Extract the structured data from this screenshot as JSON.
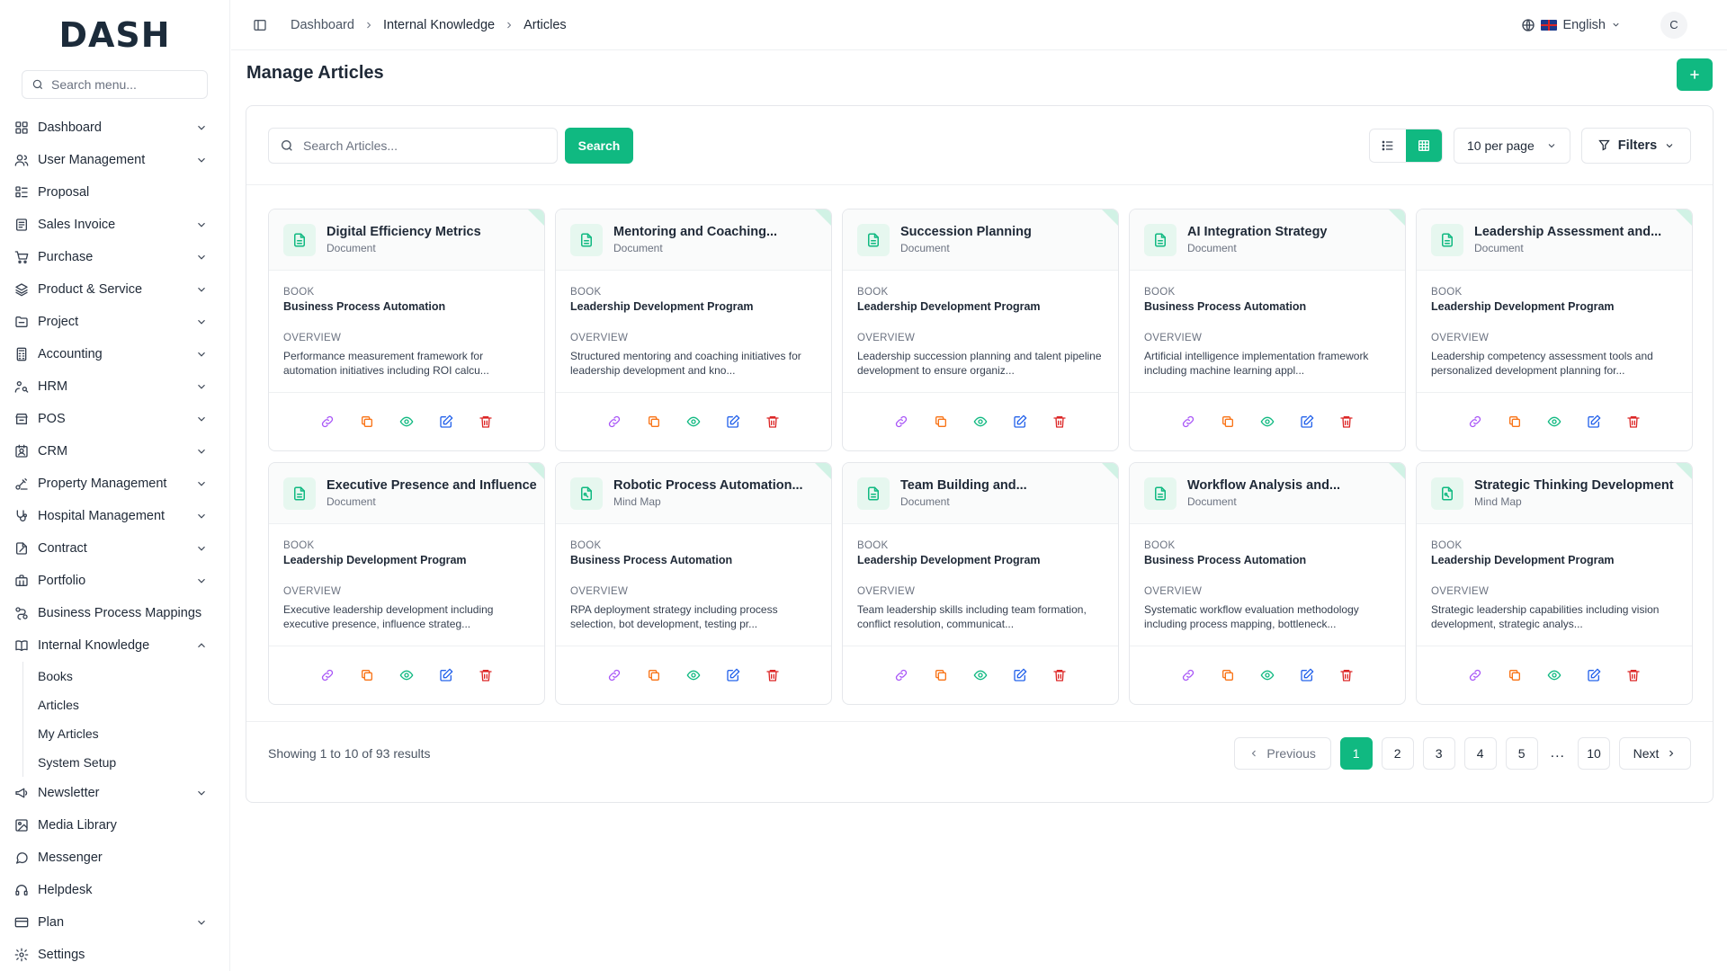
{
  "brand": {
    "logo_text": "DASH"
  },
  "sidebar": {
    "search_placeholder": "Search menu...",
    "items": [
      {
        "label": "Dashboard",
        "icon": "dashboard-icon",
        "chevron": "down"
      },
      {
        "label": "User Management",
        "icon": "users-icon",
        "chevron": "down"
      },
      {
        "label": "Proposal",
        "icon": "proposal-icon",
        "chevron": ""
      },
      {
        "label": "Sales Invoice",
        "icon": "invoice-icon",
        "chevron": "down"
      },
      {
        "label": "Purchase",
        "icon": "cart-icon",
        "chevron": "down"
      },
      {
        "label": "Product & Service",
        "icon": "layers-icon",
        "chevron": "down"
      },
      {
        "label": "Project",
        "icon": "folder-icon",
        "chevron": "down"
      },
      {
        "label": "Accounting",
        "icon": "calculator-icon",
        "chevron": "down"
      },
      {
        "label": "HRM",
        "icon": "hrm-icon",
        "chevron": "down"
      },
      {
        "label": "POS",
        "icon": "pos-icon",
        "chevron": "down"
      },
      {
        "label": "CRM",
        "icon": "crm-icon",
        "chevron": "down"
      },
      {
        "label": "Property Management",
        "icon": "property-icon",
        "chevron": "down"
      },
      {
        "label": "Hospital Management",
        "icon": "stethoscope-icon",
        "chevron": "down"
      },
      {
        "label": "Contract",
        "icon": "contract-icon",
        "chevron": "down"
      },
      {
        "label": "Portfolio",
        "icon": "briefcase-icon",
        "chevron": "down"
      },
      {
        "label": "Business Process Mappings",
        "icon": "process-icon",
        "chevron": ""
      },
      {
        "label": "Internal Knowledge",
        "icon": "book-icon",
        "chevron": "up"
      }
    ],
    "sub_items": [
      "Books",
      "Articles",
      "My Articles",
      "System Setup"
    ],
    "items_after": [
      {
        "label": "Newsletter",
        "icon": "megaphone-icon",
        "chevron": "down"
      },
      {
        "label": "Media Library",
        "icon": "image-icon",
        "chevron": ""
      },
      {
        "label": "Messenger",
        "icon": "chat-icon",
        "chevron": ""
      },
      {
        "label": "Helpdesk",
        "icon": "headset-icon",
        "chevron": ""
      },
      {
        "label": "Plan",
        "icon": "card-icon",
        "chevron": "down"
      },
      {
        "label": "Settings",
        "icon": "gear-icon",
        "chevron": ""
      }
    ]
  },
  "header": {
    "breadcrumb": [
      "Dashboard",
      "Internal Knowledge",
      "Articles"
    ],
    "language": "English",
    "avatar_initial": "C"
  },
  "page": {
    "title": "Manage Articles",
    "search_placeholder": "Search Articles...",
    "search_label": "Search",
    "per_page": "10 per page",
    "filters_label": "Filters",
    "labels": {
      "book": "BOOK",
      "overview": "OVERVIEW"
    }
  },
  "articles": [
    {
      "title": "Digital Efficiency Metrics",
      "type": "Document",
      "book": "Business Process Automation",
      "overview": "Performance measurement framework for automation initiatives including ROI calcu..."
    },
    {
      "title": "Mentoring and Coaching...",
      "type": "Document",
      "book": "Leadership Development Program",
      "overview": "Structured mentoring and coaching initiatives for leadership development and kno..."
    },
    {
      "title": "Succession Planning",
      "type": "Document",
      "book": "Leadership Development Program",
      "overview": "Leadership succession planning and talent pipeline development to ensure organiz..."
    },
    {
      "title": "AI Integration Strategy",
      "type": "Document",
      "book": "Business Process Automation",
      "overview": "Artificial intelligence implementation framework including machine learning appl..."
    },
    {
      "title": "Leadership Assessment and...",
      "type": "Document",
      "book": "Leadership Development Program",
      "overview": "Leadership competency assessment tools and personalized development planning for..."
    },
    {
      "title": "Executive Presence and Influence",
      "type": "Document",
      "book": "Leadership Development Program",
      "overview": "Executive leadership development including executive presence, influence strateg..."
    },
    {
      "title": "Robotic Process Automation...",
      "type": "Mind Map",
      "book": "Business Process Automation",
      "overview": "RPA deployment strategy including process selection, bot development, testing pr..."
    },
    {
      "title": "Team Building and...",
      "type": "Document",
      "book": "Leadership Development Program",
      "overview": "Team leadership skills including team formation, conflict resolution, communicat..."
    },
    {
      "title": "Workflow Analysis and...",
      "type": "Document",
      "book": "Business Process Automation",
      "overview": "Systematic workflow evaluation methodology including process mapping, bottleneck..."
    },
    {
      "title": "Strategic Thinking Development",
      "type": "Mind Map",
      "book": "Leadership Development Program",
      "overview": "Strategic leadership capabilities including vision development, strategic analys..."
    }
  ],
  "pagination": {
    "showing": "Showing 1 to 10 of 93 results",
    "previous": "Previous",
    "next": "Next",
    "pages": [
      "1",
      "2",
      "3",
      "4",
      "5"
    ],
    "ellipsis": "...",
    "last": "10",
    "current": "1"
  },
  "colors": {
    "accent": "#10b981",
    "link_action": "#a855f7",
    "copy_action": "#f97316",
    "view_action": "#10b981",
    "edit_action": "#2563eb",
    "delete_action": "#dc2626"
  }
}
